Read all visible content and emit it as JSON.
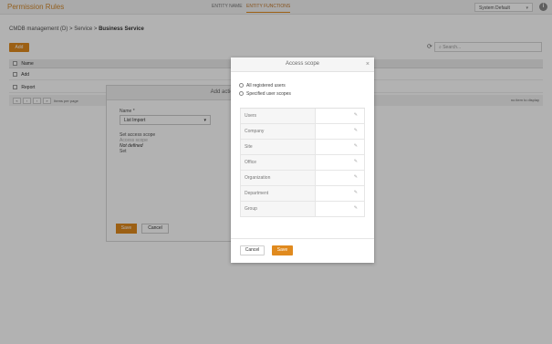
{
  "app": {
    "title": "Permission Rules"
  },
  "topnav": {
    "tab1": "ENTITY NAME",
    "tab2": "ENTITY FUNCTIONS"
  },
  "header": {
    "system_select": "System Default"
  },
  "breadcrumb": {
    "part1": "CMDB management (D)",
    "sep": ">",
    "part2": "Service",
    "part3": "Business Service"
  },
  "toolbar": {
    "add_label": "Add",
    "search_placeholder": "Search..."
  },
  "table": {
    "header": "Name",
    "rows": [
      "Add",
      "Report"
    ],
    "pager_label": "Items per page",
    "no_more": "no item to display"
  },
  "add_action": {
    "title": "Add action",
    "name_label": "Name *",
    "name_value": "List Import",
    "scope_label": "Set access scope",
    "scope_sub": "Access scope",
    "scope_value": "Not defined",
    "scope_set": "Set",
    "save": "Save",
    "cancel": "Cancel"
  },
  "modal": {
    "title": "Access scope",
    "radio_all": "All registered users",
    "radio_specified": "Specified user scopes",
    "rows": [
      "Users",
      "Company",
      "Site",
      "Office",
      "Organization",
      "Department",
      "Group"
    ],
    "cancel": "Cancel",
    "save": "Save"
  },
  "colors": {
    "accent": "#e08a1e"
  }
}
